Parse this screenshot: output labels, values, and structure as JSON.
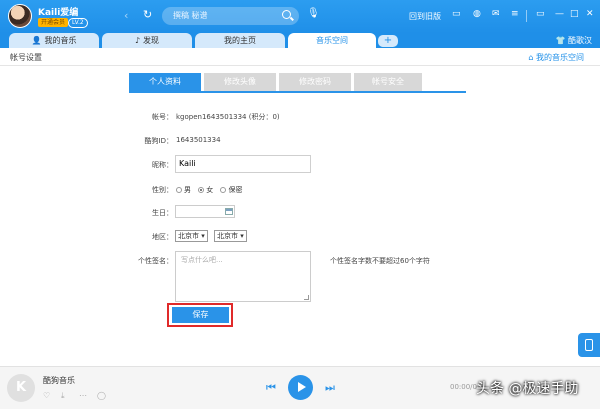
{
  "topbar": {
    "username": "Kaili爱编",
    "vip_badge": "开通会员",
    "level_badge": "LV.2",
    "search_placeholder": "撰稿 秘谱",
    "old_version": "回到旧版",
    "icons": [
      "back-icon",
      "refresh-icon",
      "search-icon",
      "mic-icon",
      "shirt-icon",
      "theme-icon",
      "mail-icon",
      "menu-icon",
      "mini-mode-icon",
      "minimize-icon",
      "maximize-icon",
      "close-icon"
    ]
  },
  "tabs": [
    {
      "label": "我的音乐",
      "icon": "👤"
    },
    {
      "label": "发现",
      "icon": "♪"
    },
    {
      "label": "我的主页",
      "icon": ""
    },
    {
      "label": "音乐空间",
      "icon": ""
    }
  ],
  "tab_add": "+",
  "skin_label": "酷歌汉",
  "subheader": {
    "title": "帐号设置",
    "my_space": "我的音乐空间"
  },
  "content_tabs": [
    "个人资料",
    "修改头像",
    "修改密码",
    "帐号安全"
  ],
  "form": {
    "account_label": "帐号：",
    "account_value": "kgopen1643501334 (积分：0)",
    "kugou_id_label": "酷狗ID：",
    "kugou_id_value": "1643501334",
    "nickname_label": "昵称：",
    "nickname_value": "Kaili",
    "gender_label": "性别：",
    "gender_options": [
      "男",
      "女",
      "保密"
    ],
    "gender_selected": "女",
    "birthday_label": "生日：",
    "region_label": "地区：",
    "province": "北京市",
    "city": "北京市",
    "signature_label": "个性签名：",
    "signature_placeholder": "写点什么吧...",
    "signature_hint": "个性签名字数不要超过60个字符",
    "save_button": "保存"
  },
  "player": {
    "logo": "K",
    "song_title": "酷狗音乐",
    "time": "00:00/0"
  },
  "watermark": "头条 @极速手助",
  "colors": {
    "accent": "#2a93e8",
    "highlight": "#e02a2a"
  }
}
